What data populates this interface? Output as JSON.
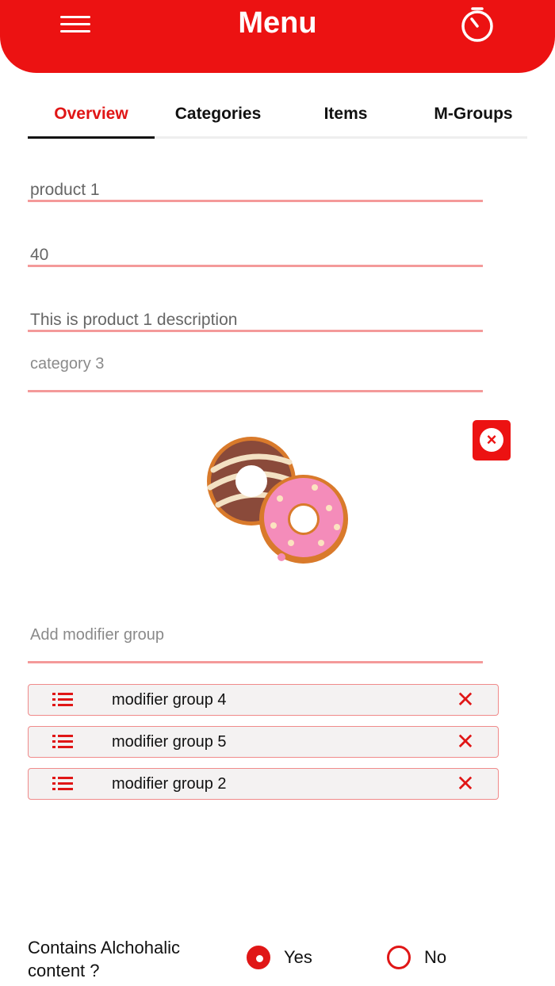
{
  "header": {
    "title": "Menu",
    "menu_icon": "hamburger-icon",
    "timer_icon": "timer-icon",
    "bg_color": "#ec1212"
  },
  "tabs": [
    {
      "label": "Overview",
      "active": true
    },
    {
      "label": "Categories",
      "active": false
    },
    {
      "label": "Items",
      "active": false
    },
    {
      "label": "M-Groups",
      "active": false
    }
  ],
  "form": {
    "name_value": "product 1",
    "price_value": "40",
    "description_value": "This is product 1 description",
    "category_placeholder": "category 3",
    "modifier_placeholder": "Add modifier group"
  },
  "image": {
    "icon": "donuts-image",
    "remove_icon": "close-circle-icon"
  },
  "modifier_groups": [
    {
      "label": "modifier group 4"
    },
    {
      "label": "modifier group 5"
    },
    {
      "label": "modifier group 2"
    }
  ],
  "alcohol": {
    "question": "Contains Alchohalic content ?",
    "options": [
      {
        "label": "Yes",
        "selected": true
      },
      {
        "label": "No",
        "selected": false
      }
    ]
  },
  "colors": {
    "accent": "#e01616",
    "field_underline": "#f49a9a"
  }
}
